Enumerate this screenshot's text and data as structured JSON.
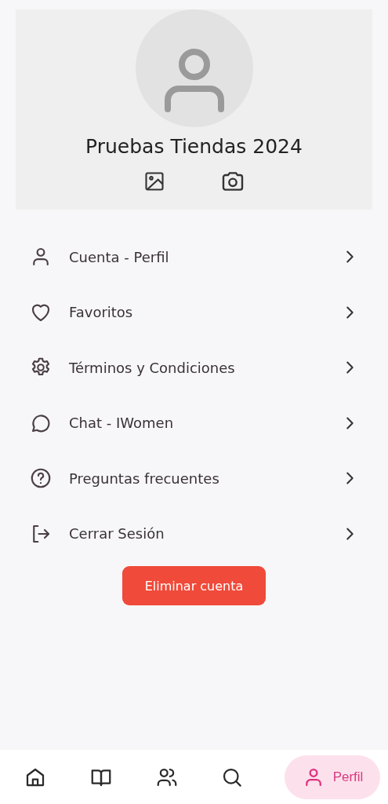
{
  "profile": {
    "name": "Pruebas Tiendas 2024"
  },
  "menu": [
    {
      "kind": "user",
      "label": "Cuenta - Perfil"
    },
    {
      "kind": "heart",
      "label": "Favoritos"
    },
    {
      "kind": "gear",
      "label": "Términos y Condiciones"
    },
    {
      "kind": "chat",
      "label": "Chat - IWomen"
    },
    {
      "kind": "help",
      "label": "Preguntas frecuentes"
    },
    {
      "kind": "logout",
      "label": "Cerrar Sesión"
    }
  ],
  "delete_button": "Eliminar cuenta",
  "nav": [
    {
      "kind": "home",
      "selected": false
    },
    {
      "kind": "book",
      "selected": false
    },
    {
      "kind": "people",
      "selected": false
    },
    {
      "kind": "search",
      "selected": false
    },
    {
      "kind": "user",
      "selected": true,
      "label": "Perfil"
    }
  ]
}
